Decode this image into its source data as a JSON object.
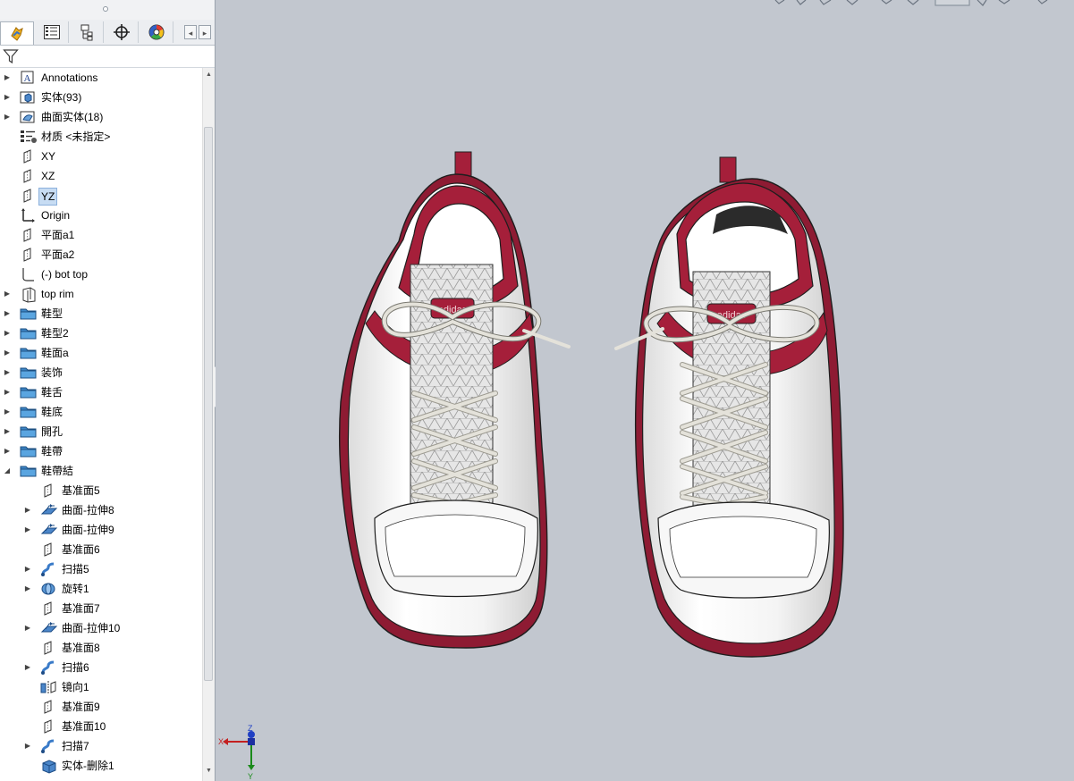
{
  "tabs": [
    {
      "icon": "feature-manager-icon",
      "active": true
    },
    {
      "icon": "property-manager-icon",
      "active": false
    },
    {
      "icon": "configuration-manager-icon",
      "active": false
    },
    {
      "icon": "dimxpert-icon",
      "active": false
    },
    {
      "icon": "display-manager-icon",
      "active": false
    }
  ],
  "tree": [
    {
      "label": "Annotations",
      "icon": "annotations-icon",
      "level": 0,
      "expander": "collapsed"
    },
    {
      "label": "实体(93)",
      "icon": "solid-bodies-icon",
      "level": 0,
      "expander": "collapsed"
    },
    {
      "label": "曲面实体(18)",
      "icon": "surface-bodies-icon",
      "level": 0,
      "expander": "collapsed"
    },
    {
      "label": "材质 <未指定>",
      "icon": "material-icon",
      "level": 0,
      "expander": "none"
    },
    {
      "label": "XY",
      "icon": "plane-icon",
      "level": 0,
      "expander": "none"
    },
    {
      "label": "XZ",
      "icon": "plane-icon",
      "level": 0,
      "expander": "none"
    },
    {
      "label": "YZ",
      "icon": "plane-icon",
      "level": 0,
      "expander": "none",
      "selected": true
    },
    {
      "label": "Origin",
      "icon": "origin-icon",
      "level": 0,
      "expander": "none"
    },
    {
      "label": "平面a1",
      "icon": "plane-icon",
      "level": 0,
      "expander": "none"
    },
    {
      "label": "平面a2",
      "icon": "plane-icon",
      "level": 0,
      "expander": "none"
    },
    {
      "label": "(-) bot top",
      "icon": "sketch-icon",
      "level": 0,
      "expander": "none"
    },
    {
      "label": "top rim",
      "icon": "3d-sketch-icon",
      "level": 0,
      "expander": "collapsed"
    },
    {
      "label": "鞋型",
      "icon": "folder-icon",
      "level": 0,
      "expander": "collapsed"
    },
    {
      "label": "鞋型2",
      "icon": "folder-icon",
      "level": 0,
      "expander": "collapsed"
    },
    {
      "label": "鞋面a",
      "icon": "folder-icon",
      "level": 0,
      "expander": "collapsed"
    },
    {
      "label": "装饰",
      "icon": "folder-icon",
      "level": 0,
      "expander": "collapsed"
    },
    {
      "label": "鞋舌",
      "icon": "folder-icon",
      "level": 0,
      "expander": "collapsed"
    },
    {
      "label": "鞋底",
      "icon": "folder-icon",
      "level": 0,
      "expander": "collapsed"
    },
    {
      "label": "開孔",
      "icon": "folder-icon",
      "level": 0,
      "expander": "collapsed"
    },
    {
      "label": "鞋帶",
      "icon": "folder-icon",
      "level": 0,
      "expander": "collapsed"
    },
    {
      "label": "鞋帶結",
      "icon": "folder-icon",
      "level": 0,
      "expander": "expanded"
    },
    {
      "label": "基准面5",
      "icon": "plane-icon",
      "level": 1,
      "expander": "none"
    },
    {
      "label": "曲面-拉伸8",
      "icon": "surface-extrude-icon",
      "level": 1,
      "expander": "collapsed"
    },
    {
      "label": "曲面-拉伸9",
      "icon": "surface-extrude-icon",
      "level": 1,
      "expander": "collapsed"
    },
    {
      "label": "基准面6",
      "icon": "plane-icon",
      "level": 1,
      "expander": "none"
    },
    {
      "label": "扫描5",
      "icon": "sweep-icon",
      "level": 1,
      "expander": "collapsed"
    },
    {
      "label": "旋转1",
      "icon": "revolve-icon",
      "level": 1,
      "expander": "collapsed"
    },
    {
      "label": "基准面7",
      "icon": "plane-icon",
      "level": 1,
      "expander": "none"
    },
    {
      "label": "曲面-拉伸10",
      "icon": "surface-extrude-icon",
      "level": 1,
      "expander": "collapsed"
    },
    {
      "label": "基准面8",
      "icon": "plane-icon",
      "level": 1,
      "expander": "none"
    },
    {
      "label": "扫描6",
      "icon": "sweep-icon",
      "level": 1,
      "expander": "collapsed"
    },
    {
      "label": "镜向1",
      "icon": "mirror-icon",
      "level": 1,
      "expander": "none"
    },
    {
      "label": "基准面9",
      "icon": "plane-icon",
      "level": 1,
      "expander": "none"
    },
    {
      "label": "基准面10",
      "icon": "plane-icon",
      "level": 1,
      "expander": "none"
    },
    {
      "label": "扫描7",
      "icon": "sweep-icon",
      "level": 1,
      "expander": "collapsed"
    },
    {
      "label": "实体-删除1",
      "icon": "delete-body-icon",
      "level": 1,
      "expander": "none"
    }
  ],
  "model": {
    "logo_text": "adidas",
    "colors": {
      "upper": "#f2f2f2",
      "trim": "#a51f3a",
      "lace": "#e4e2da",
      "mesh": "#dcdcdc",
      "outline": "#1e1e1e"
    }
  },
  "triad": {
    "x_label": "X",
    "y_label": "Y",
    "z_label": "Z"
  }
}
